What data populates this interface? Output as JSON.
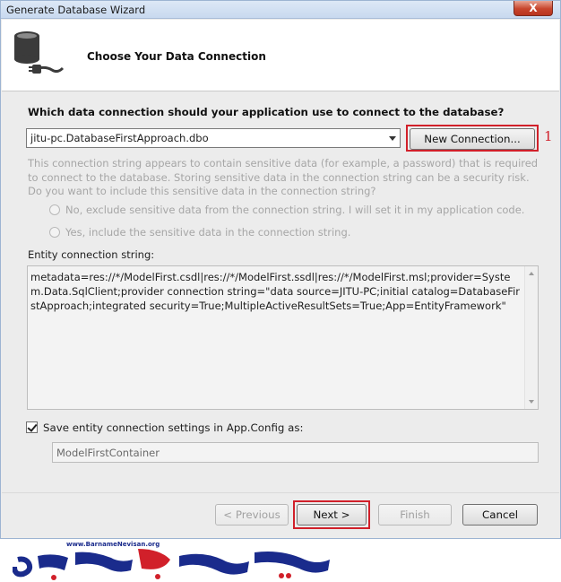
{
  "window": {
    "title": "Generate Database Wizard",
    "close_glyph": "X"
  },
  "header": {
    "title": "Choose Your Data Connection"
  },
  "question": "Which data connection should your application use to connect to the database?",
  "connection_combo": {
    "value": "jitu-pc.DatabaseFirstApproach.dbo"
  },
  "new_connection_label": "New Connection...",
  "step_marker": "1",
  "sensitive_text": "This connection string appears to contain sensitive data (for example, a password) that is required to connect to the database. Storing sensitive data in the connection string can be a security risk. Do you want to include this sensitive data in the connection string?",
  "radio_options": [
    "No, exclude sensitive data from the connection string. I will set it in my application code.",
    "Yes, include the sensitive data in the connection string."
  ],
  "entity_label": "Entity connection string:",
  "entity_connection_string": "metadata=res://*/ModelFirst.csdl|res://*/ModelFirst.ssdl|res://*/ModelFirst.msl;provider=System.Data.SqlClient;provider connection string=\"data source=JITU-PC;initial catalog=DatabaseFirstApproach;integrated security=True;MultipleActiveResultSets=True;App=EntityFramework\"",
  "save_settings": {
    "label": "Save entity connection settings in App.Config as:",
    "checked": true
  },
  "container_name": "ModelFirstContainer",
  "buttons": {
    "previous": "< Previous",
    "next": "Next >",
    "finish": "Finish",
    "cancel": "Cancel"
  },
  "logo": {
    "url": "www.BarnameNevisan.org"
  },
  "colors": {
    "highlight": "#d1202a",
    "title_bar": "#c8d9ef",
    "logo_blue": "#1a2b8c",
    "logo_red": "#d1202a"
  }
}
